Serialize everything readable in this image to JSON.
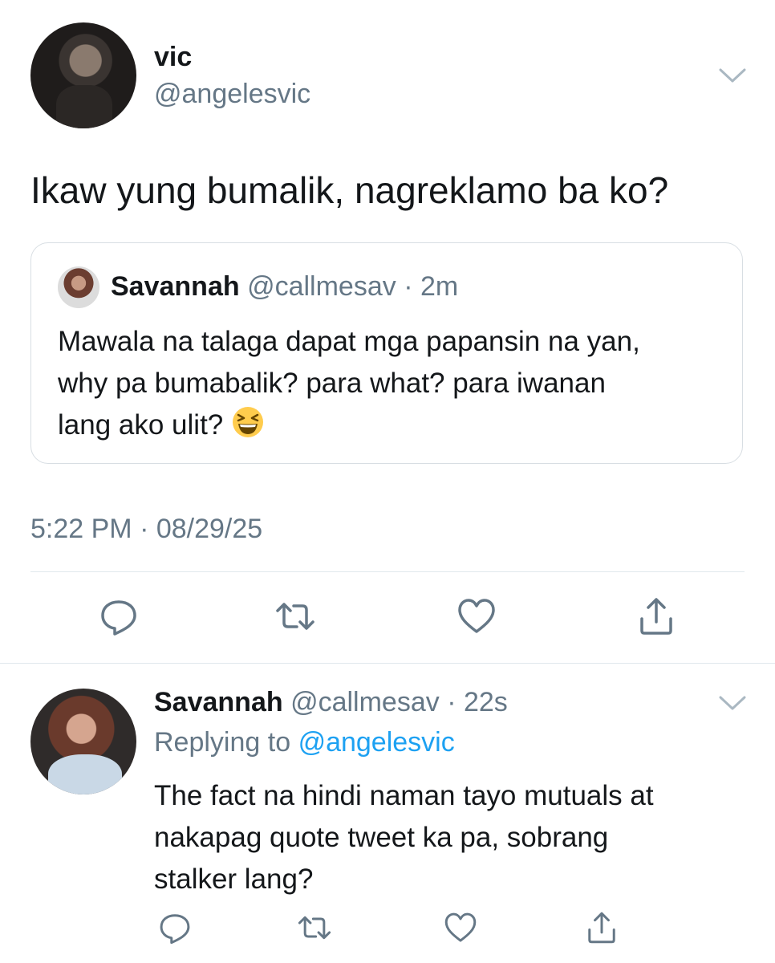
{
  "main_tweet": {
    "display_name": "vic",
    "handle": "@angelesvic",
    "text": "Ikaw yung bumalik, nagreklamo ba ko?",
    "timestamp": "5:22 PM · 08/29/25"
  },
  "quoted_tweet": {
    "display_name": "Savannah",
    "handle_time": "@callmesav · 2m",
    "line1": "Mawala na talaga dapat mga papansin na yan,",
    "line2": "why pa bumabalik? para what? para iwanan",
    "line3": "lang ako ulit?"
  },
  "reply": {
    "display_name": "Savannah",
    "handle_time": "@callmesav · 22s",
    "replying_prefix": "Replying to",
    "replying_handle": "@angelesvic",
    "line1": "The fact na hindi naman tayo mutuals at",
    "line2": "nakapag quote tweet ka pa, sobrang",
    "line3": "stalker lang?"
  },
  "icons": [
    "chevron-down-icon",
    "reply-icon",
    "retweet-icon",
    "like-icon",
    "share-icon",
    "laughing-emoji-icon"
  ],
  "colors": {
    "text": "#14171a",
    "secondary": "#657786",
    "link": "#1da1f2",
    "border": "#e1e8ed"
  }
}
